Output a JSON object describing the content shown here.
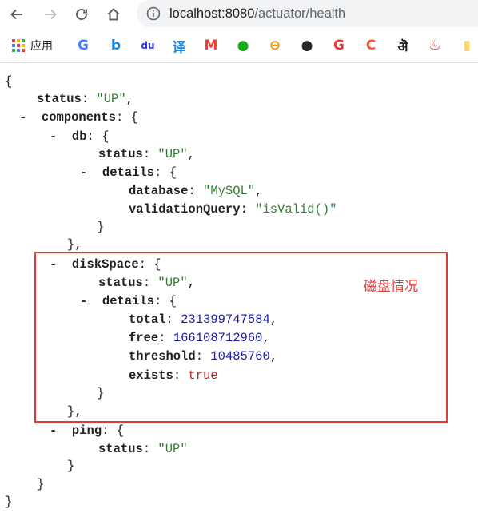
{
  "browser": {
    "url_host": "localhost:8080",
    "url_path": "/actuator/health",
    "nav": [
      "back-icon",
      "forward-icon",
      "reload-icon",
      "home-icon"
    ]
  },
  "bookmarks": {
    "apps_label": "应用",
    "items": [
      {
        "name": "google-icon",
        "glyph": "G",
        "color": "#4285f4"
      },
      {
        "name": "bing-icon",
        "glyph": "b",
        "color": "#0a84d8"
      },
      {
        "name": "baidu-icon",
        "glyph": "du",
        "color": "#2932e1"
      },
      {
        "name": "translate-icon",
        "glyph": "译",
        "color": "#1e88e5"
      },
      {
        "name": "gmail-icon",
        "glyph": "M",
        "color": "#ea4335"
      },
      {
        "name": "wechat-icon",
        "glyph": "●",
        "color": "#1aad19"
      },
      {
        "name": "link-icon",
        "glyph": "⊖",
        "color": "#fb8c00"
      },
      {
        "name": "github-icon",
        "glyph": "●",
        "color": "#24292e"
      },
      {
        "name": "g-red-icon",
        "glyph": "G",
        "color": "#e53935"
      },
      {
        "name": "csdn-icon",
        "glyph": "C",
        "color": "#fc5531"
      },
      {
        "name": "script-icon",
        "glyph": "ऄ",
        "color": "#202124"
      },
      {
        "name": "fire-icon",
        "glyph": "♨",
        "color": "#e53935"
      },
      {
        "name": "folder-icon",
        "glyph": "▮",
        "color": "#fdd663"
      }
    ]
  },
  "json": {
    "open_brace": "{",
    "close_brace": "}",
    "status_key": "status",
    "status_value": "\"UP\"",
    "components_key": "components",
    "db_key": "db",
    "db_status_value": "\"UP\"",
    "details_key": "details",
    "database_key": "database",
    "database_value": "\"MySQL\"",
    "validation_key": "validationQuery",
    "validation_value": "\"isValid()\"",
    "diskspace_key": "diskSpace",
    "diskspace_status_value": "\"UP\"",
    "total_key": "total",
    "total_value": "231399747584",
    "free_key": "free",
    "free_value": "166108712960",
    "threshold_key": "threshold",
    "threshold_value": "10485760",
    "exists_key": "exists",
    "exists_value": "true",
    "ping_key": "ping",
    "ping_status_value": "\"UP\""
  },
  "annotation": {
    "text": "磁盘情况",
    "color": "#e53935"
  }
}
